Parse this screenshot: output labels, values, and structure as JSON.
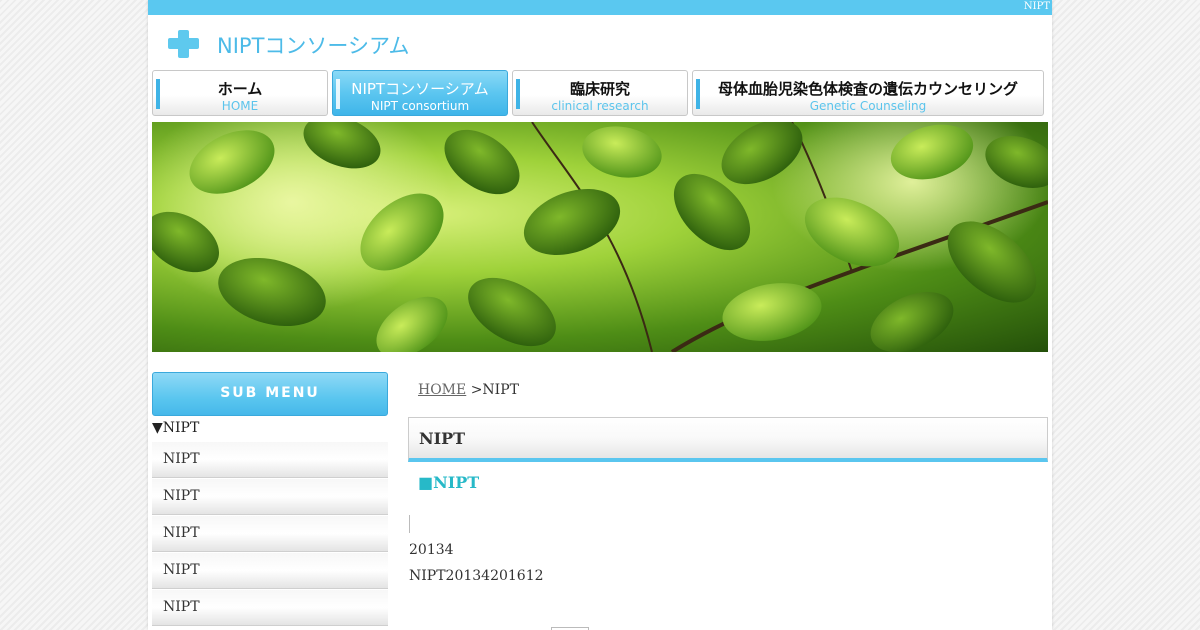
{
  "top_bar": {
    "text": "NIPT"
  },
  "logo": {
    "text": "NIPTコンソーシアム"
  },
  "nav": [
    {
      "jp": "ホーム",
      "en": "HOME"
    },
    {
      "jp": "NIPTコンソーシアム",
      "en": "NIPT consortium"
    },
    {
      "jp": "臨床研究",
      "en": "clinical research"
    },
    {
      "jp": "母体血胎児染色体検査の遺伝カウンセリング",
      "en": "Genetic Counseling"
    }
  ],
  "colors": {
    "accent": "#5ac8f0",
    "heading_teal": "#27b9c8"
  },
  "sidebar": {
    "header": "SUB MENU",
    "title": "▼NIPT",
    "items": [
      "NIPT",
      "NIPT",
      "NIPT",
      "NIPT",
      "NIPT"
    ]
  },
  "breadcrumb": {
    "home": "HOME",
    "current": ">NIPT"
  },
  "section": {
    "title": "NIPT",
    "subheading": "■NIPT",
    "lines": [
      "20134",
      "NIPT20134201612"
    ]
  }
}
